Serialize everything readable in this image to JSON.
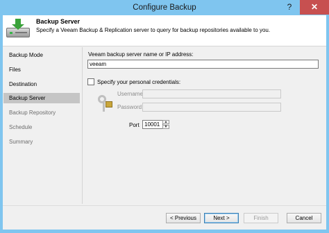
{
  "window": {
    "title": "Configure Backup",
    "help_glyph": "?",
    "close_glyph": "✕"
  },
  "header": {
    "title": "Backup Server",
    "description": "Specify a Veeam Backup & Replication server to query for backup repositories available to you."
  },
  "nav": {
    "items": [
      {
        "label": "Backup Mode"
      },
      {
        "label": "Files"
      },
      {
        "label": "Destination"
      },
      {
        "label": "Backup Server"
      },
      {
        "label": "Backup Repository"
      },
      {
        "label": "Schedule"
      },
      {
        "label": "Summary"
      }
    ],
    "selected": "Backup Server"
  },
  "form": {
    "server_label": "Veeam backup server name or IP address:",
    "server_value": "veeam",
    "credentials_label": "Specify your personal credentials:",
    "credentials_checked": false,
    "username_label": "Username:",
    "username_value": "",
    "password_label": "Password:",
    "password_value": "",
    "port_label": "Port",
    "port_value": "10001"
  },
  "footer": {
    "previous_label": "< Previous",
    "next_label": "Next >",
    "finish_label": "Finish",
    "cancel_label": "Cancel"
  }
}
